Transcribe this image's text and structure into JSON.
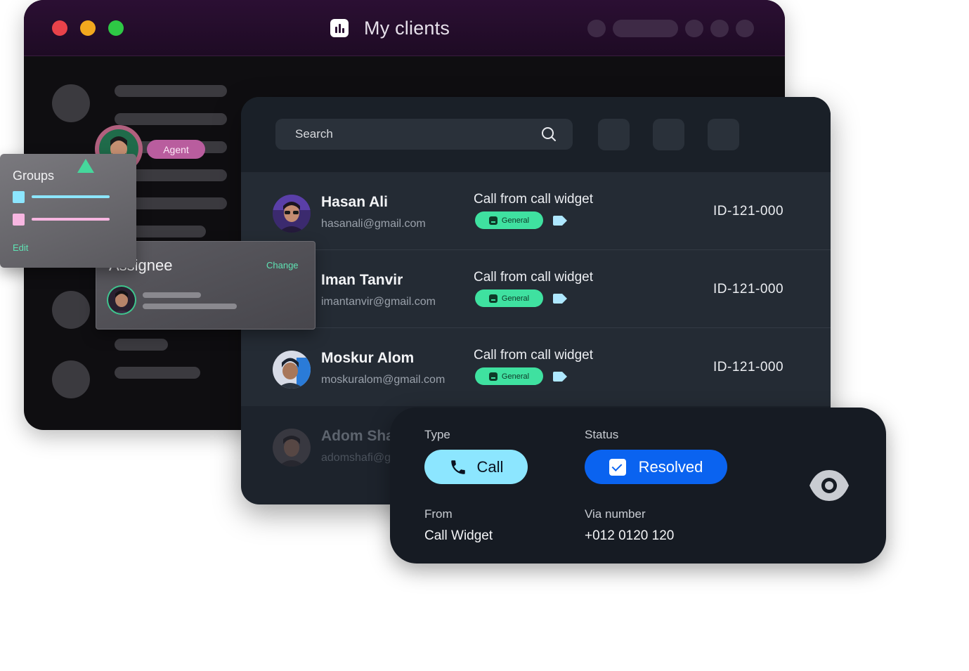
{
  "window": {
    "title": "My clients",
    "dot_colors": [
      "#e9424a",
      "#f2a81e",
      "#2ec845"
    ]
  },
  "agent_badge": {
    "label": "Agent"
  },
  "groups": {
    "title": "Groups",
    "edit_label": "Edit",
    "item_colors": [
      "#8ce6ff",
      "#f7b6e1"
    ]
  },
  "assignee": {
    "title": "Assignee",
    "change_label": "Change"
  },
  "search": {
    "placeholder": "Search"
  },
  "clients": [
    {
      "name": "Hasan Ali",
      "email": "hasanali@gmail.com",
      "source": "Call from call widget",
      "tag": "General",
      "id": "ID-121-000"
    },
    {
      "name": "Iman Tanvir",
      "email": "imantanvir@gmail.com",
      "source": "Call from call widget",
      "tag": "General",
      "id": "ID-121-000"
    },
    {
      "name": "Moskur Alom",
      "email": "moskuralom@gmail.com",
      "source": "Call from call widget",
      "tag": "General",
      "id": "ID-121-000"
    },
    {
      "name": "Adom Sha",
      "email": "adomshafi@g"
    }
  ],
  "detail": {
    "type_label": "Type",
    "type_value": "Call",
    "status_label": "Status",
    "status_value": "Resolved",
    "from_label": "From",
    "from_value": "Call Widget",
    "via_label": "Via number",
    "via_value": "+012 0120 120"
  },
  "colors": {
    "accent_green": "#3fe1a0",
    "status_blue": "#0a63f0",
    "call_cyan": "#8ce6ff",
    "agent_pink": "#b95d9e"
  }
}
